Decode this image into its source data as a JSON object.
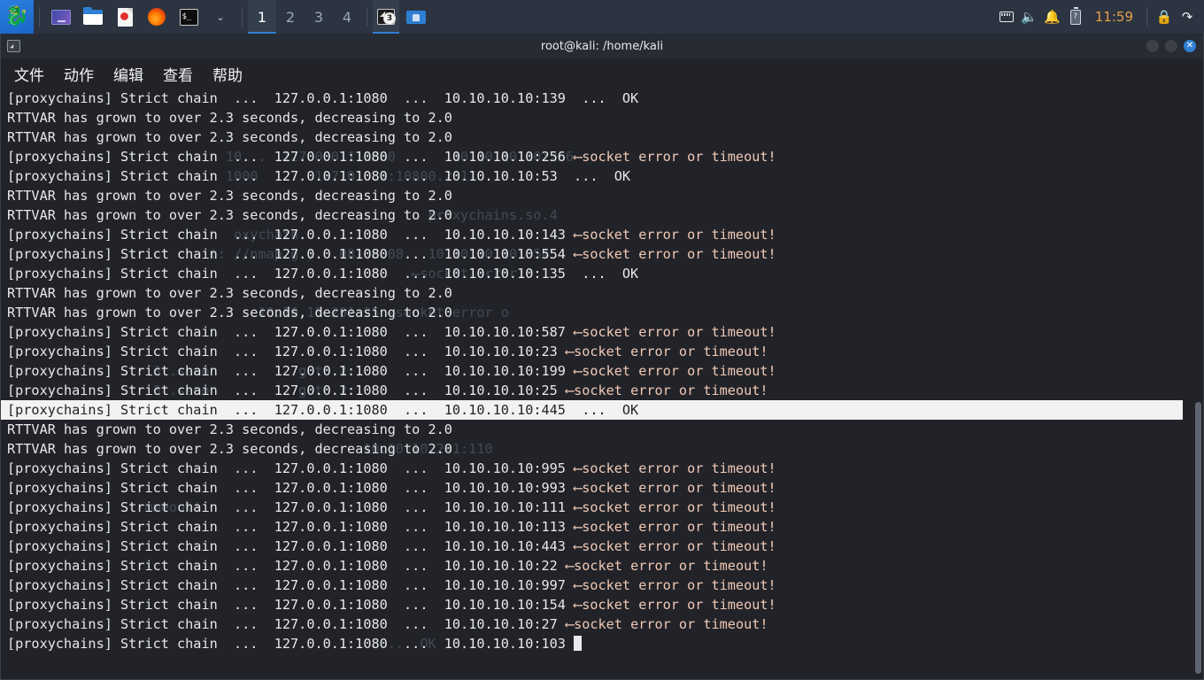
{
  "taskbar": {
    "kali_menu": "kali-dragon-logo",
    "launchers": [
      {
        "name": "display-settings-icon",
        "label": "Display"
      },
      {
        "name": "file-manager-icon",
        "label": "Files"
      },
      {
        "name": "text-editor-icon",
        "label": "Text Editor"
      },
      {
        "name": "firefox-icon",
        "label": "Firefox"
      },
      {
        "name": "terminal-icon",
        "label": "Terminal"
      }
    ],
    "launcher_chevron": "⌄",
    "workspaces": [
      "1",
      "2",
      "3",
      "4"
    ],
    "active_workspace": "1",
    "windows": [
      {
        "name": "terminal-window-button",
        "badge": "3",
        "glyph": "◣"
      },
      {
        "name": "files-window-button",
        "badge": "",
        "glyph": ""
      }
    ],
    "tray": {
      "network_icon": "network-icon",
      "volume_icon": "🔊",
      "notification_icon": "🔔",
      "battery_icon": "?",
      "clock": "11:59",
      "lock_icon": "🔒",
      "logout_icon": "↪"
    }
  },
  "window": {
    "title": "root@kali: /home/kali",
    "app_icon": "terminal-icon",
    "controls": {
      "minimize": "",
      "maximize": "",
      "close": "✕"
    },
    "menu": [
      "文件",
      "动作",
      "编辑",
      "查看",
      "帮助"
    ],
    "menu_names": [
      "menu-file",
      "menu-actions",
      "menu-edit",
      "menu-view",
      "menu-help"
    ]
  },
  "terminal": {
    "bg_color": "#222329",
    "fg_color": "#e6e8ec",
    "highlight_bg": "#f2f2f2",
    "highlight_fg": "#222329",
    "lines": [
      {
        "text": "[proxychains] Strict chain  ...  127.0.0.1:1080  ...  10.10.10.10:139  ...  OK",
        "highlight": false
      },
      {
        "text": "RTTVAR has grown to over 2.3 seconds, decreasing to 2.0",
        "highlight": false
      },
      {
        "text": "RTTVAR has grown to over 2.3 seconds, decreasing to 2.0",
        "highlight": false
      },
      {
        "text": "[proxychains] Strict chain  ...  127.0.0.1:1080  ...  10.10.10.10:256 ⟵socket error or timeout!",
        "highlight": false
      },
      {
        "text": "[proxychains] Strict chain  ...  127.0.0.1:1080  ...  10.10.10.10:53  ...  OK",
        "highlight": false
      },
      {
        "text": "RTTVAR has grown to over 2.3 seconds, decreasing to 2.0",
        "highlight": false
      },
      {
        "text": "RTTVAR has grown to over 2.3 seconds, decreasing to 2.0",
        "highlight": false
      },
      {
        "text": "[proxychains] Strict chain  ...  127.0.0.1:1080  ...  10.10.10.10:143 ⟵socket error or timeout!",
        "highlight": false
      },
      {
        "text": "[proxychains] Strict chain  ...  127.0.0.1:1080  ...  10.10.10.10:554 ⟵socket error or timeout!",
        "highlight": false
      },
      {
        "text": "[proxychains] Strict chain  ...  127.0.0.1:1080  ...  10.10.10.10:135  ...  OK",
        "highlight": false
      },
      {
        "text": "RTTVAR has grown to over 2.3 seconds, decreasing to 2.0",
        "highlight": false
      },
      {
        "text": "RTTVAR has grown to over 2.3 seconds, decreasing to 2.0",
        "highlight": false
      },
      {
        "text": "[proxychains] Strict chain  ...  127.0.0.1:1080  ...  10.10.10.10:587 ⟵socket error or timeout!",
        "highlight": false
      },
      {
        "text": "[proxychains] Strict chain  ...  127.0.0.1:1080  ...  10.10.10.10:23 ⟵socket error or timeout!",
        "highlight": false
      },
      {
        "text": "[proxychains] Strict chain  ...  127.0.0.1:1080  ...  10.10.10.10:199 ⟵socket error or timeout!",
        "highlight": false
      },
      {
        "text": "[proxychains] Strict chain  ...  127.0.0.1:1080  ...  10.10.10.10:25 ⟵socket error or timeout!",
        "highlight": false
      },
      {
        "text": "[proxychains] Strict chain  ...  127.0.0.1:1080  ...  10.10.10.10:445  ...  OK",
        "highlight": true
      },
      {
        "text": "RTTVAR has grown to over 2.3 seconds, decreasing to 2.0",
        "highlight": false
      },
      {
        "text": "RTTVAR has grown to over 2.3 seconds, decreasing to 2.0",
        "highlight": false
      },
      {
        "text": "[proxychains] Strict chain  ...  127.0.0.1:1080  ...  10.10.10.10:995 ⟵socket error or timeout!",
        "highlight": false
      },
      {
        "text": "[proxychains] Strict chain  ...  127.0.0.1:1080  ...  10.10.10.10:993 ⟵socket error or timeout!",
        "highlight": false
      },
      {
        "text": "[proxychains] Strict chain  ...  127.0.0.1:1080  ...  10.10.10.10:111 ⟵socket error or timeout!",
        "highlight": false
      },
      {
        "text": "[proxychains] Strict chain  ...  127.0.0.1:1080  ...  10.10.10.10:113 ⟵socket error or timeout!",
        "highlight": false
      },
      {
        "text": "[proxychains] Strict chain  ...  127.0.0.1:1080  ...  10.10.10.10:443 ⟵socket error or timeout!",
        "highlight": false
      },
      {
        "text": "[proxychains] Strict chain  ...  127.0.0.1:1080  ...  10.10.10.10:22 ⟵socket error or timeout!",
        "highlight": false
      },
      {
        "text": "[proxychains] Strict chain  ...  127.0.0.1:1080  ...  10.10.10.10:997 ⟵socket error or timeout!",
        "highlight": false
      },
      {
        "text": "[proxychains] Strict chain  ...  127.0.0.1:1080  ...  10.10.10.10:154 ⟵socket error or timeout!",
        "highlight": false
      },
      {
        "text": "[proxychains] Strict chain  ...  127.0.0.1:1080  ...  10.10.10.10:27 ⟵socket error or timeout!",
        "highlight": false
      },
      {
        "text": "[proxychains] Strict chain  ...  127.0.0.1:1080  ...  10.10.10.10:103 ",
        "highlight": false,
        "cursor": true
      }
    ],
    "ghost_lines": [
      "",
      "",
      "",
      "[proxychains] Strict chain 10...  127.0.0.1:1080 ...   10.10.10.10:256",
      "[proxychains] Strict chain 1000  ...  127.0.0.1:10800.201",
      "",
      "                                                    proxychains.so.4",
      "[proxychains] Strict chain  oxychain                  10.10.10.10:143",
      "[proxychains] Strict ch  t: //nmap.g )   08-09.08   10.10.10.10:554",
      "                                                  ⟵socket error o",
      "",
      "                               10.10.10.201:25 ⟵socket error o",
      "",
      "",
      "                  3 .seco           g to 2.",
      "                  3 .seco           g to 2.",
      "                                       ⟵socket error",
      "",
      "                                            10.10.10.2<1:110",
      "",
      "",
      "                 mmeout!",
      "",
      "",
      "",
      "",
      "",
      "",
      "                                              ...  OK"
    ],
    "cursor_visible": true
  },
  "scrollbar": {
    "name": "terminal-scrollbar",
    "thumb_top_pct": 53,
    "thumb_height_pct": 46
  }
}
